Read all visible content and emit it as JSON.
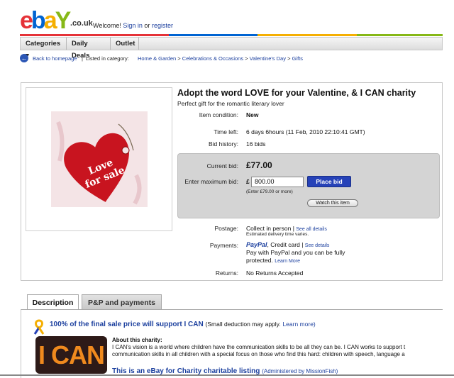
{
  "logo": {
    "letters": [
      "e",
      "b",
      "a",
      "Y"
    ],
    "suffix": ".co.uk"
  },
  "colors": {
    "e": "#e53238",
    "b": "#0064d2",
    "a": "#f5af02",
    "y": "#86b817",
    "link": "#1b3f9e",
    "button": "#2642b8"
  },
  "header": {
    "welcome": "Welcome!",
    "sign_in": "Sign in",
    "or": "or",
    "register": "register"
  },
  "nav": {
    "items": [
      "Categories ▾",
      "Daily Deals",
      "Outlet"
    ]
  },
  "breadcrumb": {
    "back": "Back to homepage",
    "listed_in": "Listed in category:",
    "path": [
      "Home & Garden",
      "Celebrations & Occasions",
      "Valentine's Day",
      "Gifts"
    ]
  },
  "item": {
    "image_text_line1": "Love",
    "image_text_line2": "for sale",
    "title": "Adopt the word LOVE for your Valentine, & I CAN charity",
    "subtitle": "Perfect gift for the romantic literary lover",
    "condition_label": "Item condition:",
    "condition_value": "New",
    "time_left_label": "Time left:",
    "time_left_value": "6 days 6hours (11 Feb, 2010 22:10:41 GMT)",
    "bid_history_label": "Bid history:",
    "bid_history_value": "16 bids"
  },
  "bid": {
    "current_label": "Current bid:",
    "current_value": "£77.00",
    "max_label": "Enter maximum bid:",
    "currency": "£",
    "max_value": "800.00",
    "hint": "(Enter £79.00 or more)",
    "place_bid": "Place bid",
    "watch": "Watch this item"
  },
  "postage": {
    "label": "Postage:",
    "value": "Collect in person",
    "see_all": "See all details",
    "estimate": "Estimated delivery time varies."
  },
  "payments": {
    "label": "Payments:",
    "paypal": "PayPal",
    "credit": ", Credit card",
    "see_details": "See details",
    "line2": "Pay with PayPal and you can be fully",
    "line3": "protected.",
    "learn_more": "Learn More"
  },
  "returns": {
    "label": "Returns:",
    "value": "No Returns Accepted"
  },
  "tabs": [
    "Description",
    "P&P and payments"
  ],
  "charity": {
    "percent": "100% of the final sale price will support",
    "org": "I CAN",
    "note": "(Small deduction may apply.",
    "learn_more": "Learn more)",
    "logo_text": "I CAN",
    "about_title": "About this charity:",
    "about_line1": "I CAN's vision is a world where children have the communication skills to be all they can be. I CAN works to support t",
    "about_line2": "communication skills in all children with a special focus on those who find this hard: children with speech, language a",
    "listing_prefix": "This is an",
    "listing_link": "eBay for Charity",
    "listing_suffix": "charitable listing",
    "administered": "(Administered by MissionFish)"
  }
}
